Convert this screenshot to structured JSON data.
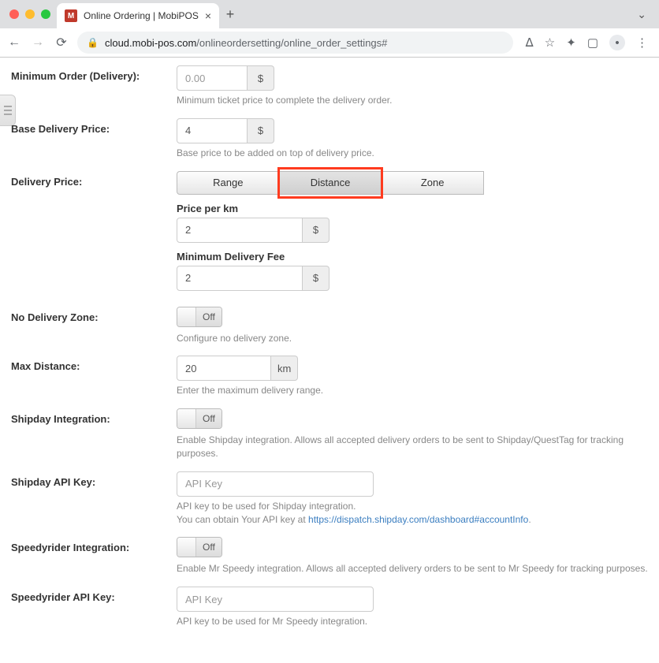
{
  "browser": {
    "tab_title": "Online Ordering | MobiPOS",
    "url_host": "cloud.mobi-pos.com",
    "url_path": "/onlineordersetting/online_order_settings#",
    "favicon_letter": "M"
  },
  "fields": {
    "min_order": {
      "label": "Minimum Order (Delivery):",
      "placeholder": "0.00",
      "value": "",
      "unit": "$",
      "help": "Minimum ticket price to complete the delivery order."
    },
    "base_price": {
      "label": "Base Delivery Price:",
      "value": "4",
      "unit": "$",
      "help": "Base price to be added on top of delivery price."
    },
    "delivery_price": {
      "label": "Delivery Price:",
      "tabs": [
        "Range",
        "Distance",
        "Zone"
      ],
      "active_tab": "Distance",
      "price_per_km_label": "Price per km",
      "price_per_km_value": "2",
      "price_per_km_unit": "$",
      "min_fee_label": "Minimum Delivery Fee",
      "min_fee_value": "2",
      "min_fee_unit": "$"
    },
    "no_delivery_zone": {
      "label": "No Delivery Zone:",
      "state": "Off",
      "help": "Configure no delivery zone."
    },
    "max_distance": {
      "label": "Max Distance:",
      "value": "20",
      "unit": "km",
      "help": "Enter the maximum delivery range."
    },
    "shipday_integration": {
      "label": "Shipday Integration:",
      "state": "Off",
      "help": "Enable Shipday integration. Allows all accepted delivery orders to be sent to Shipday/QuestTag for tracking purposes."
    },
    "shipday_api": {
      "label": "Shipday API Key:",
      "placeholder": "API Key",
      "value": "",
      "help_pre": "API key to be used for Shipday integration.",
      "help_line2_pre": "You can obtain Your API key at ",
      "help_link_text": "https://dispatch.shipday.com/dashboard#accountInfo",
      "help_line2_post": "."
    },
    "speedyrider_integration": {
      "label": "Speedyrider Integration:",
      "state": "Off",
      "help": "Enable Mr Speedy integration. Allows all accepted delivery orders to be sent to Mr Speedy for tracking purposes."
    },
    "speedyrider_api": {
      "label": "Speedyrider API Key:",
      "placeholder": "API Key",
      "value": "",
      "help": "API key to be used for Mr Speedy integration."
    }
  }
}
